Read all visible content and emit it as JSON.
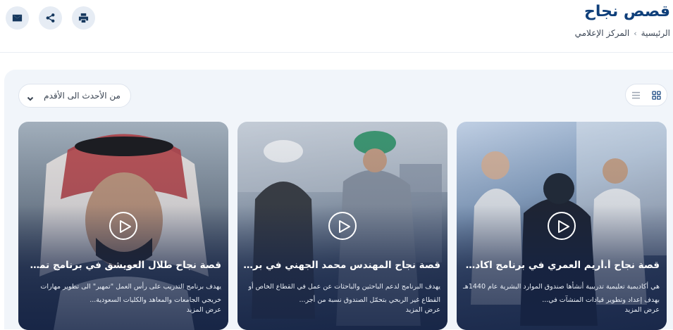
{
  "header": {
    "title": "قصص نجاح",
    "breadcrumb": {
      "home": "الرئيسية",
      "current": "المركز الإعلامي"
    },
    "actions": [
      {
        "icon": "email-icon"
      },
      {
        "icon": "share-icon"
      },
      {
        "icon": "print-icon"
      }
    ]
  },
  "toolbar": {
    "sort_value": "من الأحدث الى الأقدم",
    "view_modes": [
      "grid-view-icon",
      "list-view-icon"
    ],
    "active_view": "grid"
  },
  "cards": [
    {
      "title": "قصة نجاح أ.أريم العمري في برنامج اكاديمية...",
      "desc": "هي أكاديمية تعليمية تدريبية أنشأها صندوق الموارد البشرية عام 1440هـ بهدف إعداد وتطوير قيادات المنشآت في...",
      "more": "عرض المزيد"
    },
    {
      "title": "قصة نجاح المهندس محمد الجهني في برنامـ...",
      "desc": "يهدف البرنامج لدعم الباحثين والباحثات عن عمل في القطاع الخاص أو القطاع غير الربحي بتحمّل الصندوق نسبة من أجر...",
      "more": "عرض المزيد"
    },
    {
      "title": "قصة نجاح طلال العويشق في برنامج تمهير",
      "desc": "يهدف برنامج التدريب على رأس العمل \"تمهير\" الى تطوير مهارات خريجي الجامعات والمعاهد والكليات السعودية...",
      "more": "عرض المزيد"
    }
  ],
  "colors": {
    "brand": "#0f3f7a",
    "panel_bg": "#f1f5fa",
    "icon_bg": "#e6ecf4"
  }
}
